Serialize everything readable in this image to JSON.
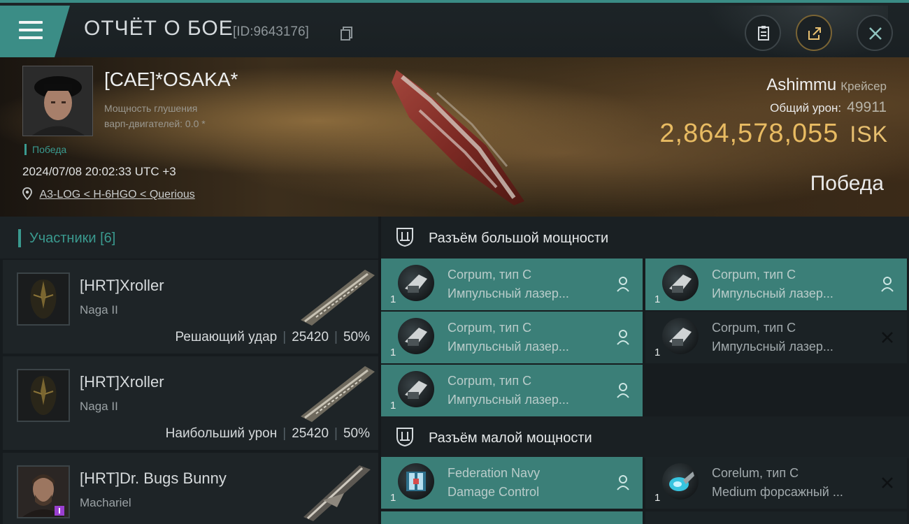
{
  "header": {
    "title": "ОТЧЁТ О БОЕ",
    "report_id": "[ID:9643176]"
  },
  "victim": {
    "name": "[CAE]*OSAKA*",
    "warp_strength_line1": "Мощность глушения",
    "warp_strength_line2": "варп-двигателей: 0.0 *",
    "result_tag": "Победа",
    "timestamp": "2024/07/08 20:02:33 UTC +3",
    "location": "A3-LOG < H-6HGO < Querious",
    "ship_name": "Ashimmu",
    "ship_class": "Крейсер",
    "total_damage_label": "Общий урон:",
    "total_damage": "49911",
    "isk_value": "2,864,578,055",
    "isk_unit": "ISK",
    "result": "Победа"
  },
  "participants": {
    "title": "Участники [6]",
    "items": [
      {
        "name": "[HRT]Xroller",
        "ship": "Naga II",
        "role": "Решающий удар",
        "damage": "25420",
        "percent": "50%"
      },
      {
        "name": "[HRT]Xroller",
        "ship": "Naga II",
        "role": "Наибольший урон",
        "damage": "25420",
        "percent": "50%"
      },
      {
        "name": "[HRT]Dr. Bugs Bunny",
        "ship": "Machariel",
        "role": "",
        "damage": "",
        "percent": ""
      }
    ]
  },
  "fitting": {
    "high_slots_title": "Разъём большой мощности",
    "low_slots_title": "Разъём малой мощности",
    "high_modules": [
      {
        "name": "Corpum, тип C",
        "type": "Импульсный лазер...",
        "qty": "1",
        "status": "dropped"
      },
      {
        "name": "Corpum, тип C",
        "type": "Импульсный лазер...",
        "qty": "1",
        "status": "dropped"
      },
      {
        "name": "Corpum, тип C",
        "type": "Импульсный лазер...",
        "qty": "1",
        "status": "dropped"
      },
      {
        "name": "Corpum, тип C",
        "type": "Импульсный лазер...",
        "qty": "1",
        "status": "destroyed"
      },
      {
        "name": "Corpum, тип C",
        "type": "Импульсный лазер...",
        "qty": "1",
        "status": "dropped"
      }
    ],
    "low_modules": [
      {
        "name": "Federation Navy",
        "type": "Damage Control",
        "qty": "1",
        "status": "dropped"
      },
      {
        "name": "Corelum, тип C",
        "type": "Medium форсажный ...",
        "qty": "1",
        "status": "destroyed"
      }
    ]
  },
  "colors": {
    "accent": "#3a8c85",
    "isk": "#e8bb62",
    "active_module": "#3b7f78"
  }
}
